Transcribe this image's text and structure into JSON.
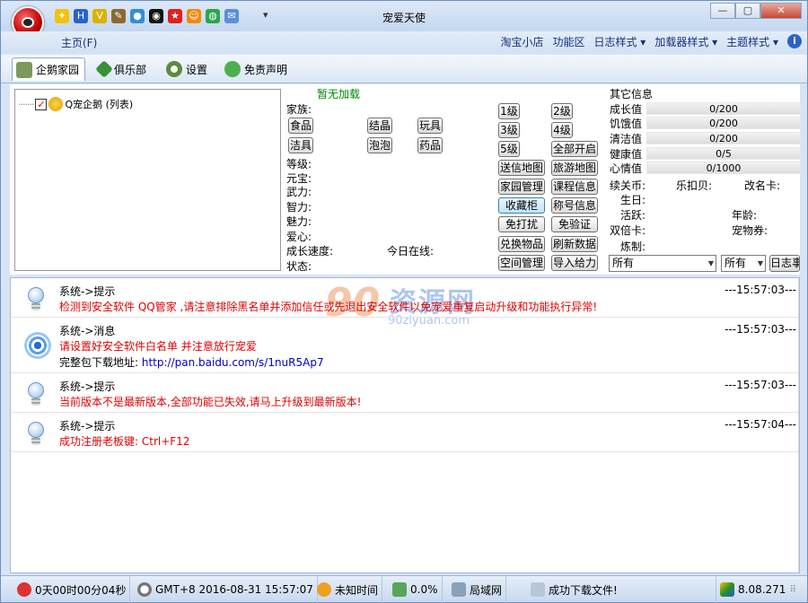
{
  "window": {
    "title": "宠爱天使"
  },
  "menu": {
    "home": "主页(F)",
    "right": [
      "淘宝小店",
      "功能区",
      "日志样式 ▾",
      "加载器样式 ▾",
      "主题样式 ▾"
    ]
  },
  "tabs": [
    "企鹅家园",
    "俱乐部",
    "设置",
    "免责声明"
  ],
  "tree": {
    "item": "Q宠企鹅 (列表)"
  },
  "info": {
    "status": "暂无加载",
    "family": "家族:",
    "buttons_left": [
      "食品",
      "结晶",
      "玩具",
      "洁具",
      "泡泡",
      "药品"
    ],
    "labels": [
      "等级:",
      "元宝:",
      "武力:",
      "智力:",
      "魅力:",
      "爱心:",
      "成长速度:",
      "状态:"
    ],
    "online_today": "今日在线:"
  },
  "actions": {
    "col1": [
      "1级",
      "3级",
      "5级",
      "送信地图",
      "家园管理",
      "收藏柜",
      "免打扰",
      "兑换物品",
      "空间管理"
    ],
    "col2": [
      "2级",
      "4级",
      "全部开启",
      "旅游地图",
      "课程信息",
      "称号信息",
      "免验证",
      "刷新数据",
      "导入给力"
    ]
  },
  "other": {
    "title": "其它信息",
    "stats": [
      {
        "label": "成长值",
        "value": "0/200"
      },
      {
        "label": "饥饿值",
        "value": "0/200"
      },
      {
        "label": "清洁值",
        "value": "0/200"
      },
      {
        "label": "健康值",
        "value": "0/5"
      },
      {
        "label": "心情值",
        "value": "0/1000"
      }
    ],
    "fields_row1": [
      "续关币:",
      "乐扣贝:",
      "改名卡:"
    ],
    "fields_mid": [
      "生日:",
      "活跃:",
      "年龄:",
      "双倍卡:",
      "宠物券:",
      "炼制:"
    ],
    "select1": "所有",
    "select2": "所有",
    "log_btn": "日志事"
  },
  "messages": [
    {
      "head": "系统->提示",
      "time": "---15:57:03---",
      "lines": [
        "检测到安全软件 QQ管家 ,请注意排除黑名单并添加信任或先退出安全软件以免宠爱重复启动升级和功能执行异常!"
      ]
    },
    {
      "head": "系统->消息",
      "time": "---15:57:03---",
      "lines": [
        "请设置好安全软件白名单 并注意放行宠爱"
      ],
      "dl_label": "完整包下载地址: ",
      "dl_link": "http://pan.baidu.com/s/1nuR5Ap7"
    },
    {
      "head": "系统->提示",
      "time": "---15:57:03---",
      "lines": [
        "当前版本不是最新版本,全部功能已失效,请马上升级到最新版本!"
      ]
    },
    {
      "head": "系统->提示",
      "time": "---15:57:04---",
      "lines": [
        "成功注册老板键: Ctrl+F12"
      ]
    }
  ],
  "watermark": {
    "big": "资源网",
    "small": "90ziyuan.com",
    "num": "90"
  },
  "status": {
    "uptime": "0天00时00分04秒",
    "clock": "GMT+8 2016-08-31 15:57:07",
    "time_state": "未知时间",
    "percent": "0.0%",
    "network": "局域网",
    "download": "成功下载文件!",
    "version": "8.08.271"
  }
}
